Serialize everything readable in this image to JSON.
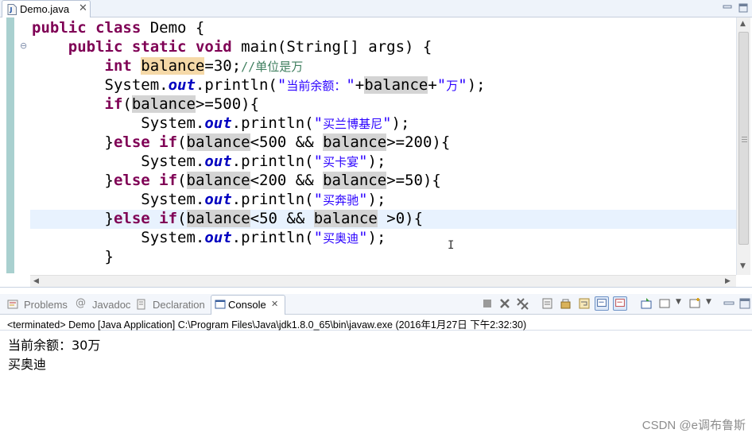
{
  "editor": {
    "tab": {
      "title": "Demo.java",
      "close": "✕",
      "icon": "java-file-icon"
    },
    "window_controls": [
      "minimize-icon",
      "maximize-icon"
    ],
    "code": {
      "l1": {
        "a": "public",
        "b": " ",
        "c": "class",
        "d": " Demo {"
      },
      "l2": {
        "a": "    ",
        "b": "public",
        "c": " ",
        "d": "static",
        "e": " ",
        "f": "void",
        "g": " main(String[] args) {"
      },
      "l3": {
        "a": "        ",
        "b": "int",
        "c": " ",
        "d": "balance",
        "e": "=30;",
        "f": "//单位是万"
      },
      "l4": {
        "a": "        System.",
        "b": "out",
        "c": ".println(",
        "d": "\"",
        "e": "当前余额：",
        "f": "\"",
        "g": "+",
        "h": "balance",
        "i": "+",
        "j": "\"",
        "k": "万",
        "l": "\"",
        "m": ");"
      },
      "l5": {
        "a": "        ",
        "b": "if",
        "c": "(",
        "d": "balance",
        "e": ">=500){"
      },
      "l6": {
        "a": "            System.",
        "b": "out",
        "c": ".println(",
        "d": "\"",
        "e": "买兰博基尼",
        "f": "\"",
        "g": ");"
      },
      "l7": {
        "a": "        }",
        "b": "else",
        "c": " ",
        "d": "if",
        "e": "(",
        "f": "balance",
        "g": "<500 && ",
        "h": "balance",
        "i": ">=200){"
      },
      "l8": {
        "a": "            System.",
        "b": "out",
        "c": ".println(",
        "d": "\"",
        "e": "买卡宴",
        "f": "\"",
        "g": ");"
      },
      "l9": {
        "a": "        }",
        "b": "else",
        "c": " ",
        "d": "if",
        "e": "(",
        "f": "balance",
        "g": "<200 && ",
        "h": "balance",
        "i": ">=50){"
      },
      "l10": {
        "a": "            System.",
        "b": "out",
        "c": ".println(",
        "d": "\"",
        "e": "买奔驰",
        "f": "\"",
        "g": ");"
      },
      "l11": {
        "a": "        }",
        "b": "else",
        "c": " ",
        "d": "if",
        "e": "(",
        "f": "bala",
        "g": "|",
        "h": "nce",
        "i": "<50 && ",
        "j": "balance",
        "k": " >0){"
      },
      "l12": {
        "a": "            System.",
        "b": "out",
        "c": ".println(",
        "d": "\"",
        "e": "买奥迪",
        "f": "\"",
        "g": ");"
      },
      "l13": {
        "a": "        }"
      }
    }
  },
  "views": {
    "tabs": [
      {
        "label": "Problems",
        "icon": "problems-icon"
      },
      {
        "label": "Javadoc",
        "icon": "at-sign-icon"
      },
      {
        "label": "Declaration",
        "icon": "declaration-icon"
      },
      {
        "label": "Console",
        "icon": "console-icon",
        "close": "✕",
        "active": true
      }
    ]
  },
  "console": {
    "status": "<terminated> Demo [Java Application] C:\\Program Files\\Java\\jdk1.8.0_65\\bin\\javaw.exe (2016年1月27日 下午2:32:30)",
    "output": [
      "当前余额：30万",
      "买奥迪"
    ]
  },
  "watermark": "CSDN @e调布鲁斯",
  "colors": {
    "keyword": "#7f0055",
    "field": "#0000c0",
    "string": "#2a00ff",
    "comment": "#3f7f5f",
    "current_line": "#e8f2fe",
    "occurrence_highlight": "#d4d4d4"
  }
}
